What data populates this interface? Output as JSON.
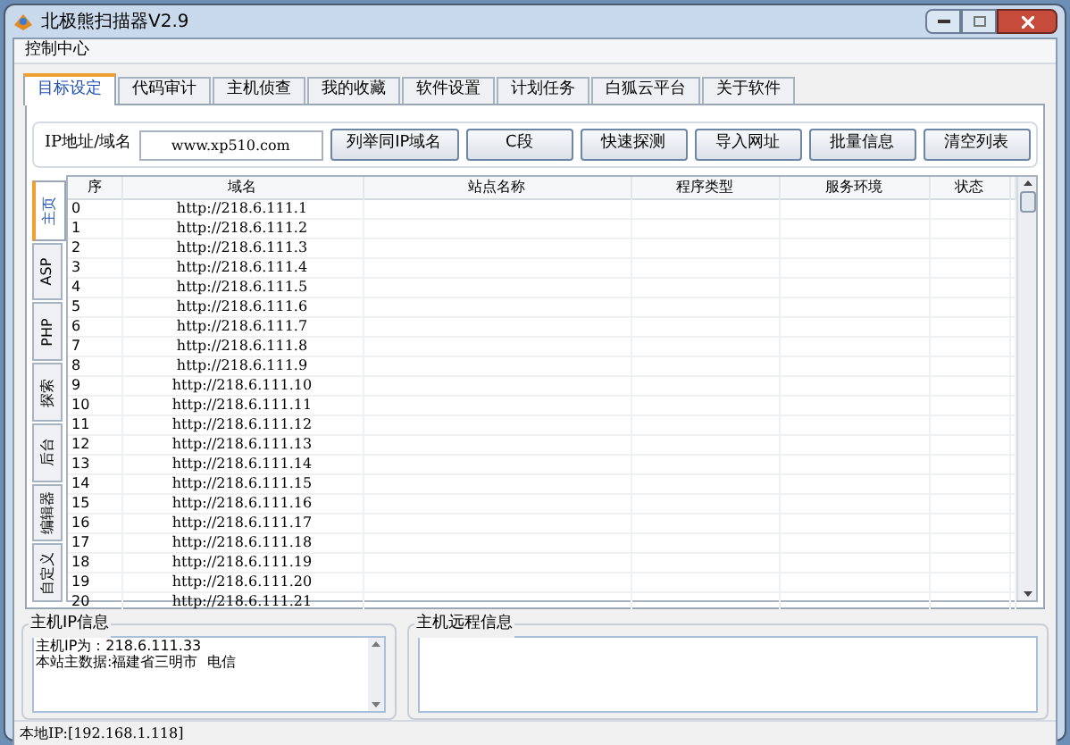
{
  "window": {
    "title": "北极熊扫描器V2.9"
  },
  "menu": [
    "控制中心"
  ],
  "tabs": [
    {
      "label": "目标设定",
      "selected": true
    },
    {
      "label": "代码审计",
      "selected": false
    },
    {
      "label": "主机侦查",
      "selected": false
    },
    {
      "label": "我的收藏",
      "selected": false
    },
    {
      "label": "软件设置",
      "selected": false
    },
    {
      "label": "计划任务",
      "selected": false
    },
    {
      "label": "白狐云平台",
      "selected": false
    },
    {
      "label": "关于软件",
      "selected": false
    }
  ],
  "target": {
    "label": "IP地址/域名",
    "value": "www.xp510.com"
  },
  "buttons": [
    "列举同IP域名",
    "C段",
    "快速探测",
    "导入网址",
    "批量信息",
    "清空列表"
  ],
  "side_tabs": [
    {
      "label": "主页",
      "selected": true
    },
    {
      "label": "ASP",
      "selected": false
    },
    {
      "label": "PHP",
      "selected": false
    },
    {
      "label": "探索",
      "selected": false
    },
    {
      "label": "后台",
      "selected": false
    },
    {
      "label": "编辑器",
      "selected": false
    },
    {
      "label": "自定义",
      "selected": false
    }
  ],
  "table": {
    "columns": [
      "序",
      "域名",
      "站点名称",
      "程序类型",
      "服务环境",
      "状态"
    ],
    "rows": [
      [
        "0",
        "http://218.6.111.1"
      ],
      [
        "1",
        "http://218.6.111.2"
      ],
      [
        "2",
        "http://218.6.111.3"
      ],
      [
        "3",
        "http://218.6.111.4"
      ],
      [
        "4",
        "http://218.6.111.5"
      ],
      [
        "5",
        "http://218.6.111.6"
      ],
      [
        "6",
        "http://218.6.111.7"
      ],
      [
        "7",
        "http://218.6.111.8"
      ],
      [
        "8",
        "http://218.6.111.9"
      ],
      [
        "9",
        "http://218.6.111.10"
      ],
      [
        "10",
        "http://218.6.111.11"
      ],
      [
        "11",
        "http://218.6.111.12"
      ],
      [
        "12",
        "http://218.6.111.13"
      ],
      [
        "13",
        "http://218.6.111.14"
      ],
      [
        "14",
        "http://218.6.111.15"
      ],
      [
        "15",
        "http://218.6.111.16"
      ],
      [
        "16",
        "http://218.6.111.17"
      ],
      [
        "17",
        "http://218.6.111.18"
      ],
      [
        "18",
        "http://218.6.111.19"
      ],
      [
        "19",
        "http://218.6.111.20"
      ],
      [
        "20",
        "http://218.6.111.21"
      ]
    ]
  },
  "host_ip_info": {
    "title": "主机IP信息",
    "lines": [
      "主机IP为：218.6.111.33",
      "本站主数据:福建省三明市  电信"
    ]
  },
  "host_remote_info": {
    "title": "主机远程信息"
  },
  "status_bar": "本地IP:[192.168.1.118]"
}
